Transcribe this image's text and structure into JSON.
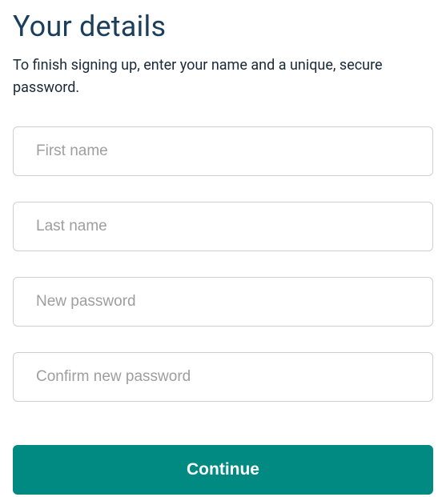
{
  "header": {
    "title": "Your details",
    "subtitle": "To finish signing up, enter your name and a unique, secure password."
  },
  "form": {
    "first_name": {
      "placeholder": "First name",
      "value": ""
    },
    "last_name": {
      "placeholder": "Last name",
      "value": ""
    },
    "new_password": {
      "placeholder": "New password",
      "value": ""
    },
    "confirm_password": {
      "placeholder": "Confirm new password",
      "value": ""
    }
  },
  "actions": {
    "continue_label": "Continue"
  },
  "colors": {
    "accent": "#008a82",
    "title": "#1a3e5c"
  }
}
